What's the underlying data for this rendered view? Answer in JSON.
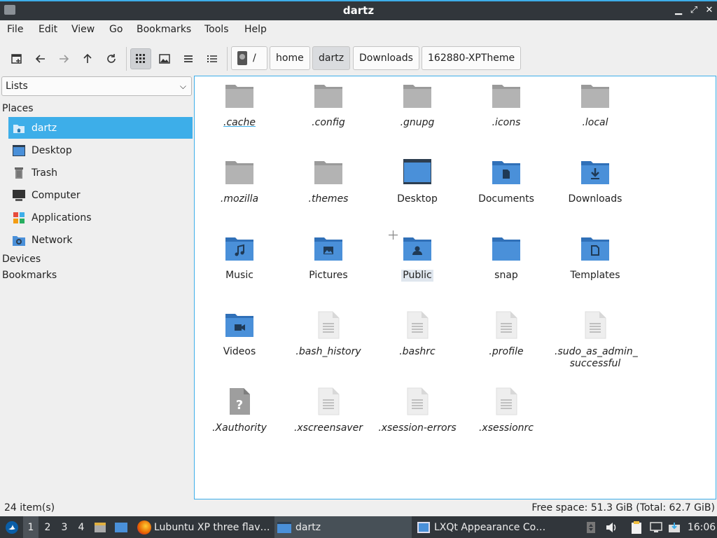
{
  "window": {
    "title": "dartz"
  },
  "menu": [
    "File",
    "Edit",
    "View",
    "Go",
    "Bookmarks",
    "Tools",
    "Help"
  ],
  "breadcrumb": {
    "root": "/",
    "parts": [
      "home",
      "dartz",
      "Downloads",
      "162880-XPTheme"
    ],
    "current_index": 1
  },
  "sidebar": {
    "mode": "Lists",
    "places_header": "Places",
    "places": [
      {
        "label": "dartz",
        "icon": "home-folder-icon"
      },
      {
        "label": "Desktop",
        "icon": "desktop-icon"
      },
      {
        "label": "Trash",
        "icon": "trash-icon"
      },
      {
        "label": "Computer",
        "icon": "computer-icon"
      },
      {
        "label": "Applications",
        "icon": "applications-icon"
      },
      {
        "label": "Network",
        "icon": "network-icon"
      }
    ],
    "devices_header": "Devices",
    "bookmarks_header": "Bookmarks"
  },
  "files": [
    {
      "name": ".cache",
      "kind": "folder-grey"
    },
    {
      "name": ".config",
      "kind": "folder-grey"
    },
    {
      "name": ".gnupg",
      "kind": "folder-grey"
    },
    {
      "name": ".icons",
      "kind": "folder-grey"
    },
    {
      "name": ".local",
      "kind": "folder-grey"
    },
    {
      "name": ".mozilla",
      "kind": "folder-grey"
    },
    {
      "name": ".themes",
      "kind": "folder-grey"
    },
    {
      "name": "Desktop",
      "kind": "desktop"
    },
    {
      "name": "Documents",
      "kind": "folder-documents"
    },
    {
      "name": "Downloads",
      "kind": "folder-downloads"
    },
    {
      "name": "Music",
      "kind": "folder-music"
    },
    {
      "name": "Pictures",
      "kind": "folder-pictures"
    },
    {
      "name": "Public",
      "kind": "folder-public"
    },
    {
      "name": "snap",
      "kind": "folder-blue"
    },
    {
      "name": "Templates",
      "kind": "folder-templates"
    },
    {
      "name": "Videos",
      "kind": "folder-videos"
    },
    {
      "name": ".bash_history",
      "kind": "text-file"
    },
    {
      "name": ".bashrc",
      "kind": "text-file"
    },
    {
      "name": ".profile",
      "kind": "text-file"
    },
    {
      "name": ".sudo_as_admin_ successful",
      "kind": "text-file"
    },
    {
      "name": ".Xauthority",
      "kind": "unknown-file"
    },
    {
      "name": ".xscreensaver",
      "kind": "text-file"
    },
    {
      "name": ".xsession-errors",
      "kind": "text-file"
    },
    {
      "name": ".xsessionrc",
      "kind": "text-file"
    }
  ],
  "status": {
    "count": "24 item(s)",
    "free_space": "Free space: 51.3 GiB (Total: 62.7 GiB)"
  },
  "taskbar": {
    "desktops": [
      "1",
      "2",
      "3",
      "4"
    ],
    "active_desktop": "1",
    "tasks": [
      {
        "label": "Lubuntu XP three flav…",
        "icon": "firefox-icon"
      },
      {
        "label": "dartz",
        "icon": "folder-icon"
      },
      {
        "label": "LXQt Appearance Co…",
        "icon": "appearance-icon"
      }
    ],
    "clock": "16:06"
  },
  "colors": {
    "accent": "#3daee9",
    "folder_blue": "#4a90d9",
    "folder_grey": "#b3b3b3",
    "panel": "#31363b"
  }
}
